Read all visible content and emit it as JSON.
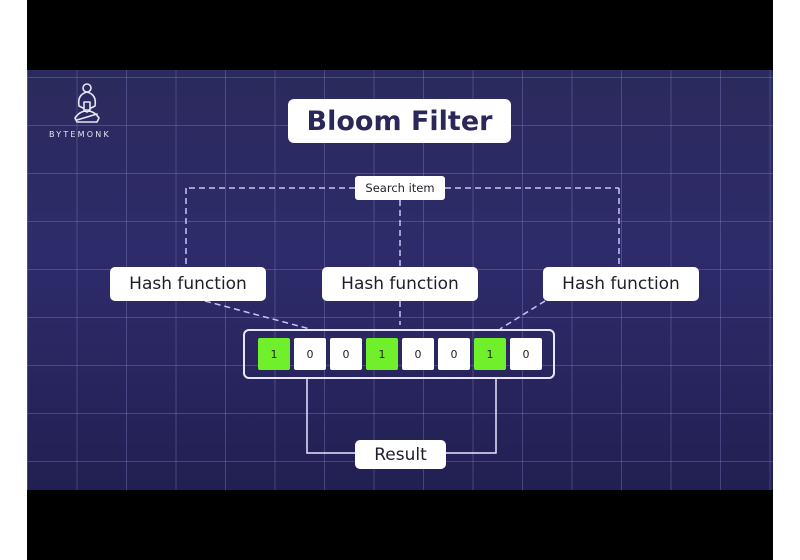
{
  "brand": {
    "logo_icon": "meditating-monk-icon",
    "name": "BYTEMONK"
  },
  "diagram": {
    "title": "Bloom Filter",
    "search_label": "Search item",
    "hash_functions": [
      {
        "label": "Hash function"
      },
      {
        "label": "Hash function"
      },
      {
        "label": "Hash function"
      }
    ],
    "bit_array": {
      "bits": [
        "1",
        "0",
        "0",
        "1",
        "0",
        "0",
        "1",
        "0"
      ],
      "set_color": "#6ff02a",
      "unset_color": "#ffffff"
    },
    "result_label": "Result"
  },
  "colors": {
    "background": "#2e2b6b",
    "letterbox": "#000000",
    "label_text": "#1e1e2a",
    "title_text": "#2a2859"
  }
}
